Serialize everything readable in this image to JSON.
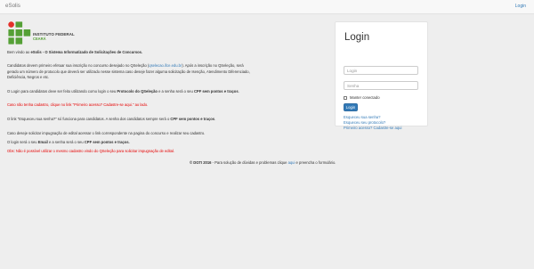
{
  "navbar": {
    "brand": "eSolis",
    "login_link": "Login"
  },
  "logo": {
    "title": "INSTITUTO FEDERAL",
    "subtitle": "CEARÁ"
  },
  "content": {
    "welcome_pre": "Bem vindo ao ",
    "welcome_bold": "eSolis - O Sistema Informatizado de Solicitações de Concursos.",
    "p1_pre": "Candidatos devem primeiro efetuar sua inscrição no concurso desejado no QSeleção (",
    "p1_link": "qselecao.ifce.edu.br",
    "p1_post": "). Após a inscrição no QSeleção, será",
    "p1_line2": "gerado um número de protocolo que deverá ser utilizado nesse sistema caso deseje fazer alguma solicitação de Isenção, Atendimento Diferenciado,",
    "p1_line3": "Deficiência, Negros e etc.",
    "p2_pre": "O Login para candidatos deve ser feito utilizando como login o seu ",
    "p2_bold1": "Protocolo do QSeleção",
    "p2_mid": " e a senha será o seu ",
    "p2_bold2": "CPF sem pontos e traços",
    "p2_post": ".",
    "p3": "Caso não tenha cadastro, clique no link \"Primeiro acesso? Cadastre-se aqui.\" ao lado.",
    "p4_pre": "O link \"Esqueceu sua senha?\" só funciona para candidatos. A senha dos candidatos sempre será o ",
    "p4_bold": "CPF sem pontos e traços",
    "p4_post": ".",
    "p5": "Caso deseje solicitar impugnação de edital acessar o link correspondente na pagina do concurso e realizar seu cadastro.",
    "p6_pre": "O login será o seu ",
    "p6_bold1": "Email",
    "p6_mid": " e a senha será o seu ",
    "p6_bold2": "CPF sem pontos e traços.",
    "p7": "Obs: Não é possível utilizar o mesmo cadastro vindo do QSeleção para solicitar impugnação de edital."
  },
  "login_panel": {
    "title": "Login",
    "login_placeholder": "Login",
    "senha_placeholder": "Senha",
    "keep_connected": "Manter conectado",
    "button": "Login",
    "forgot_password": "Esqueceu sua senha?",
    "forgot_protocol": "Esqueceu seu protocolo?",
    "first_access": "Primeiro acesso? Cadastre-se aqui"
  },
  "footer": {
    "bold": "© DGTI 2016",
    "text_pre": " - Para solução de dúvidas e problemas clique ",
    "link": "aqui",
    "text_post": " e preencha o formulário."
  },
  "colors": {
    "accent": "#337ab7",
    "alert": "#e60000",
    "logo_green": "#55a036",
    "logo_red": "#e3312b"
  }
}
